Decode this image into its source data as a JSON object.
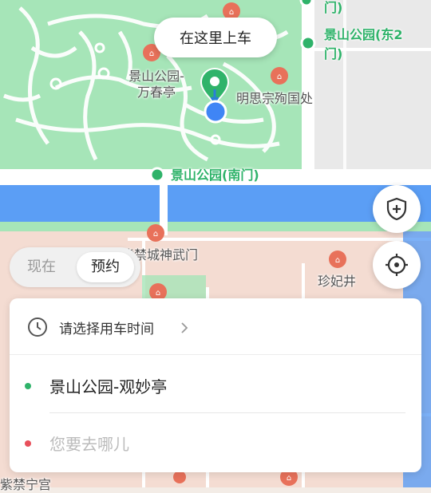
{
  "map": {
    "pickup_bubble": "在这里上车",
    "labels": {
      "park_pavilion": "景山公园-万春亭",
      "memorial": "明思宗殉国处",
      "east_gate": "景山公园(东2门)",
      "east_gate_line1": "景山公园(东2",
      "east_gate_line2": "门)",
      "south_gate": "景山公园(南门)",
      "shenwu_gate": "紫禁城神武门",
      "zhenfei_well": "珍妃井",
      "top_partial": "门)",
      "bottom_partial": "紫禁宁宫"
    },
    "colors": {
      "park": "#a6e5b8",
      "water": "#5b9ef5",
      "palace": "#f4dcd2",
      "pickup_pin": "#2fb36a",
      "location_dot": "#3f85f5"
    }
  },
  "controls": {
    "safety_icon": "shield-plus-icon",
    "locate_icon": "crosshair-icon"
  },
  "mode": {
    "now": "现在",
    "book": "预约"
  },
  "panel": {
    "time_prompt": "请选择用车时间",
    "origin": "景山公园-观妙亭",
    "destination_placeholder": "您要去哪儿",
    "origin_dot_color": "#2fb36a",
    "destination_dot_color": "#e8505b"
  }
}
